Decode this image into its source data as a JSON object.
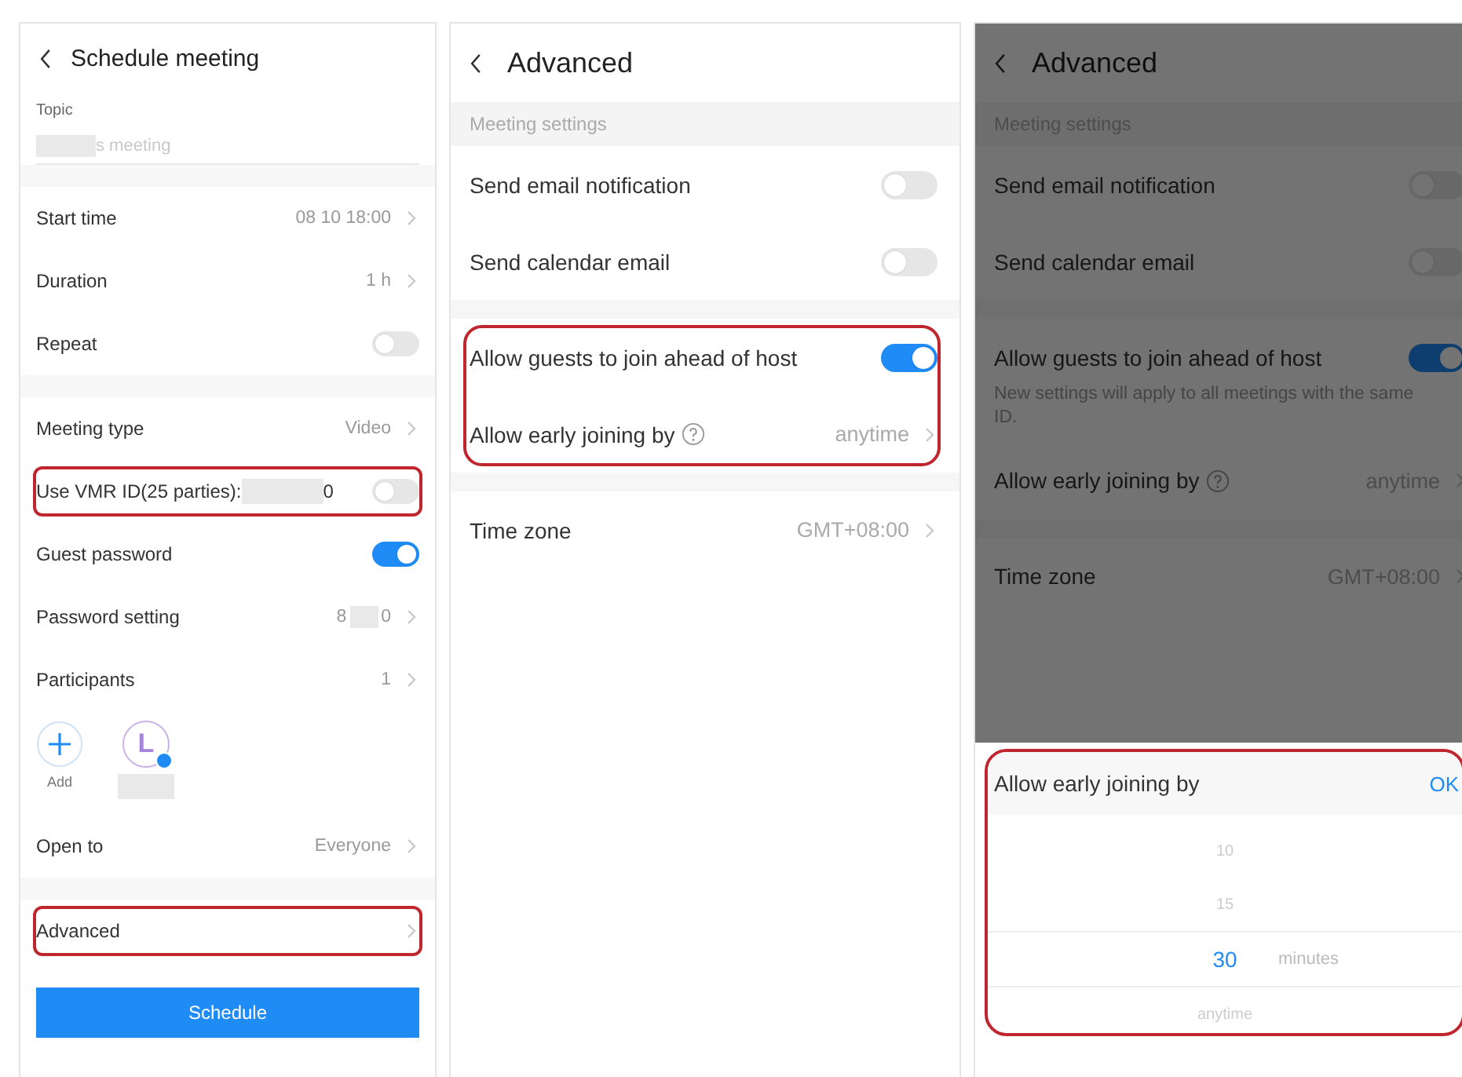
{
  "schedule": {
    "title": "Schedule meeting",
    "topic": {
      "label": "Topic",
      "placeholder": "s meeting"
    },
    "sections": [
      {
        "rows": [
          {
            "kind": "value",
            "label": "Start time",
            "value": "08 10 18:00",
            "highlighted": false
          },
          {
            "kind": "value",
            "label": "Duration",
            "value": "1 h",
            "highlighted": false
          },
          {
            "kind": "toggle",
            "label": "Repeat",
            "on": false,
            "highlighted": false
          }
        ]
      },
      {
        "rows": [
          {
            "kind": "value",
            "label": "Meeting type",
            "value": "Video",
            "highlighted": false
          },
          {
            "kind": "toggle",
            "label": "Use VMR ID(25 parties):",
            "suffix": "0",
            "on": false,
            "highlighted": true
          },
          {
            "kind": "toggle",
            "label": "Guest password",
            "on": true,
            "highlighted": false
          },
          {
            "kind": "value",
            "label": "Password setting",
            "value": "8",
            "suffix": "0",
            "highlighted": false
          },
          {
            "kind": "value",
            "label": "Participants",
            "value": "1",
            "highlighted": false
          },
          {
            "kind": "participants",
            "add_label": "Add",
            "avatar_letter": "L"
          },
          {
            "kind": "value",
            "label": "Open to",
            "value": "Everyone",
            "highlighted": false
          }
        ]
      },
      {
        "rows": [
          {
            "kind": "link",
            "label": "Advanced",
            "highlighted": true
          }
        ]
      }
    ],
    "button": "Schedule"
  },
  "advanced": {
    "title": "Advanced",
    "section_header": "Meeting settings",
    "sections": [
      {
        "highlighted": false,
        "rows": [
          {
            "kind": "toggle",
            "label": "Send email notification",
            "on": false
          },
          {
            "kind": "toggle",
            "label": "Send calendar email",
            "on": false
          }
        ]
      },
      {
        "highlighted": true,
        "rows": [
          {
            "kind": "toggle",
            "label": "Allow guests to join ahead of host",
            "on": true
          },
          {
            "kind": "value",
            "label": "Allow early joining by",
            "help": true,
            "value": "anytime"
          }
        ]
      },
      {
        "highlighted": false,
        "rows": [
          {
            "kind": "value",
            "label": "Time zone",
            "help": false,
            "value": "GMT+08:00"
          }
        ]
      }
    ]
  },
  "advanced_dimmed": {
    "title": "Advanced",
    "section_header": "Meeting settings",
    "sections": [
      {
        "highlighted": false,
        "rows": [
          {
            "kind": "toggle",
            "label": "Send email notification",
            "on": false
          },
          {
            "kind": "toggle",
            "label": "Send calendar email",
            "on": false
          }
        ]
      },
      {
        "highlighted": false,
        "rows": [
          {
            "kind": "toggle",
            "label": "Allow guests to join ahead of host",
            "on": true
          },
          {
            "kind": "note",
            "text": "New settings will apply to all meetings with the same ID."
          },
          {
            "kind": "value",
            "label": "Allow early joining by",
            "help": true,
            "value": "anytime"
          }
        ]
      },
      {
        "highlighted": false,
        "rows": [
          {
            "kind": "value",
            "label": "Time zone",
            "help": false,
            "value": "GMT+08:00"
          }
        ]
      }
    ],
    "picker": {
      "title": "Allow early joining by",
      "ok": "OK",
      "highlighted": true,
      "options": [
        {
          "label": "10",
          "selected": false
        },
        {
          "label": "15",
          "selected": false
        },
        {
          "label": "30",
          "selected": true,
          "unit": "minutes"
        },
        {
          "label": "anytime",
          "selected": false
        }
      ]
    }
  }
}
